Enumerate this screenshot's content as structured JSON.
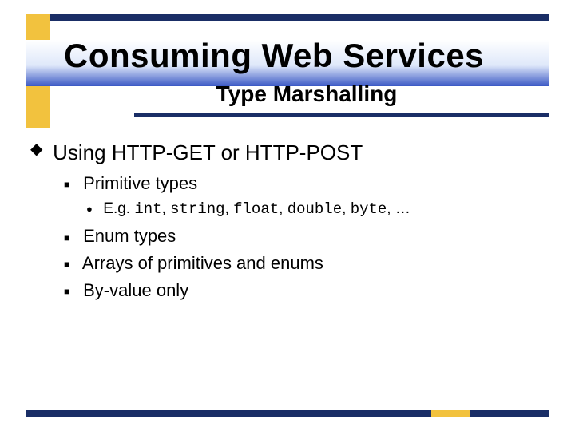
{
  "colors": {
    "navy": "#1a2e66",
    "gold": "#f2c23e",
    "gradient_top": "#ffffff",
    "gradient_mid": "#dfe8fa",
    "gradient_bottom": "#3b59c5"
  },
  "header": {
    "title": "Consuming Web Services",
    "subtitle": "Type Marshalling"
  },
  "body": {
    "main_bullet_glyph": "◆",
    "main_text": "Using HTTP-GET or HTTP-POST",
    "items": [
      {
        "bullet": "■",
        "text": "Primitive types",
        "sub": {
          "bullet": "●",
          "prefix": "E.g. ",
          "code1": "int",
          "sep1": ", ",
          "code2": "string",
          "sep2": ", ",
          "code3": "float",
          "sep3": ", ",
          "code4": "double",
          "sep4": ", ",
          "code5": "byte",
          "suffix": ", …"
        }
      },
      {
        "bullet": "■",
        "text": "Enum types"
      },
      {
        "bullet": "■",
        "text": "Arrays of primitives and enums"
      },
      {
        "bullet": "■",
        "text": "By-value only"
      }
    ]
  }
}
